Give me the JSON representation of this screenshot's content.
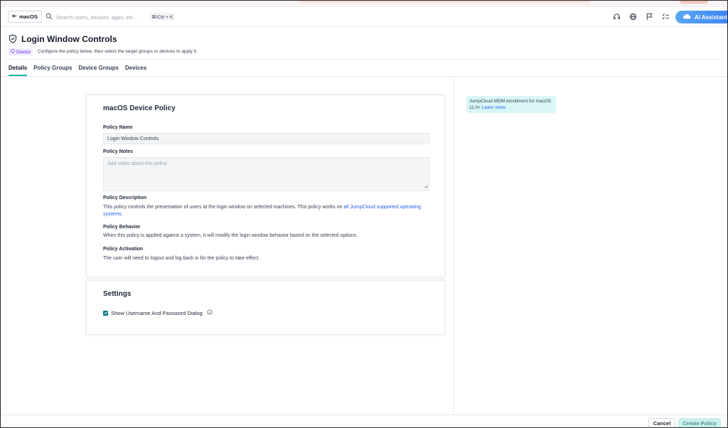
{
  "header": {
    "back_label": "macOS",
    "search_placeholder": "Search users, devices, apps, etc...",
    "shortcut": "⌘/Ctrl + K",
    "ai_label": "AI Assistant",
    "icons": [
      "headset-icon",
      "globe-icon",
      "flag-icon",
      "checklist-icon"
    ]
  },
  "page": {
    "title": "Login Window Controls",
    "badge": "Device",
    "subtitle": "Configure the policy below, then select the target groups or devices to apply it."
  },
  "tabs": [
    "Details",
    "Policy Groups",
    "Device Groups",
    "Devices"
  ],
  "card": {
    "title": "macOS Device Policy",
    "policy_name_label": "Policy Name",
    "policy_name_value": "Login Window Controls",
    "policy_notes_label": "Policy Notes",
    "policy_notes_placeholder": "Add notes about this policy",
    "description_label": "Policy Description",
    "description_text": "This policy controls the presentation of users at the login window on selected machines. This policy works on ",
    "description_link": "all JumpCloud supported operating systems",
    "description_end": ".",
    "behavior_label": "Policy Behavior",
    "behavior_text": "When this policy is applied against a system, it will modify the login window behavior based on the selected options.",
    "activation_label": "Policy Activation",
    "activation_text": "The user will need to logout and log back in for the policy to take effect."
  },
  "settings": {
    "title": "Settings",
    "checkbox_label": "Show Username And Password Dialog",
    "checked": true
  },
  "info": {
    "text": "JumpCloud MDM enrollment for macOS 11.0+",
    "link": "Learn more"
  },
  "footer": {
    "cancel": "Cancel",
    "create": "Create Policy"
  },
  "colors": {
    "accent": "#14b8a6",
    "ai_gradient_start": "#5aa8f2",
    "ai_gradient_end": "#3b82f6",
    "link": "#2563eb",
    "badge_bg": "#ede9fe",
    "info_bg": "#d9f6f6",
    "create_bg": "#c9f0ec"
  }
}
